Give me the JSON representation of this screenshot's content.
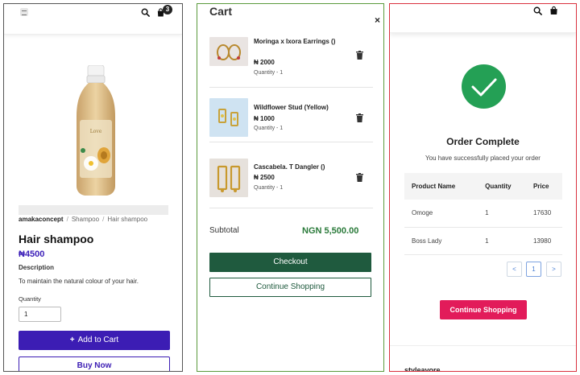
{
  "product_page": {
    "cart_count": "3",
    "breadcrumb": [
      "amakaconcept",
      "Shampoo",
      "Hair shampoo"
    ],
    "product_name": "Hair shampoo",
    "price": "₦4500",
    "description_label": "Description",
    "description": "To maintain the natural colour of your hair.",
    "quantity_label": "Quantity",
    "quantity_value": "1",
    "add_to_cart_label": "Add to Cart",
    "buy_now_label": "Buy Now"
  },
  "cart": {
    "title": "Cart",
    "close_label": "×",
    "items": [
      {
        "name": "Moringa x Ixora Earrings ()",
        "price": "₦ 2000",
        "quantity": "Quantity - 1"
      },
      {
        "name": "Wildflower Stud (Yellow)",
        "price": "₦ 1000",
        "quantity": "Quantity - 1"
      },
      {
        "name": "Cascabela. T Dangler ()",
        "price": "₦ 2500",
        "quantity": "Quantity - 1"
      }
    ],
    "subtotal_label": "Subtotal",
    "subtotal_value": "NGN 5,500.00",
    "checkout_label": "Checkout",
    "continue_label": "Continue Shopping"
  },
  "order": {
    "title": "Order Complete",
    "subtitle": "You have successfully placed your order",
    "columns": [
      "Product Name",
      "Quantity",
      "Price"
    ],
    "rows": [
      [
        "Omoge",
        "1",
        "17630"
      ],
      [
        "Boss Lady",
        "1",
        "13980"
      ]
    ],
    "pagination": {
      "prev": "<",
      "current": "1",
      "next": ">"
    },
    "continue_label": "Continue Shopping",
    "footer_brand": "styleavore"
  },
  "colors": {
    "purple": "#3c1db4",
    "cart_green": "#1f5a3e",
    "subtotal_green": "#2a7a3a",
    "success_green": "#24a055",
    "pink": "#e21b5a"
  }
}
